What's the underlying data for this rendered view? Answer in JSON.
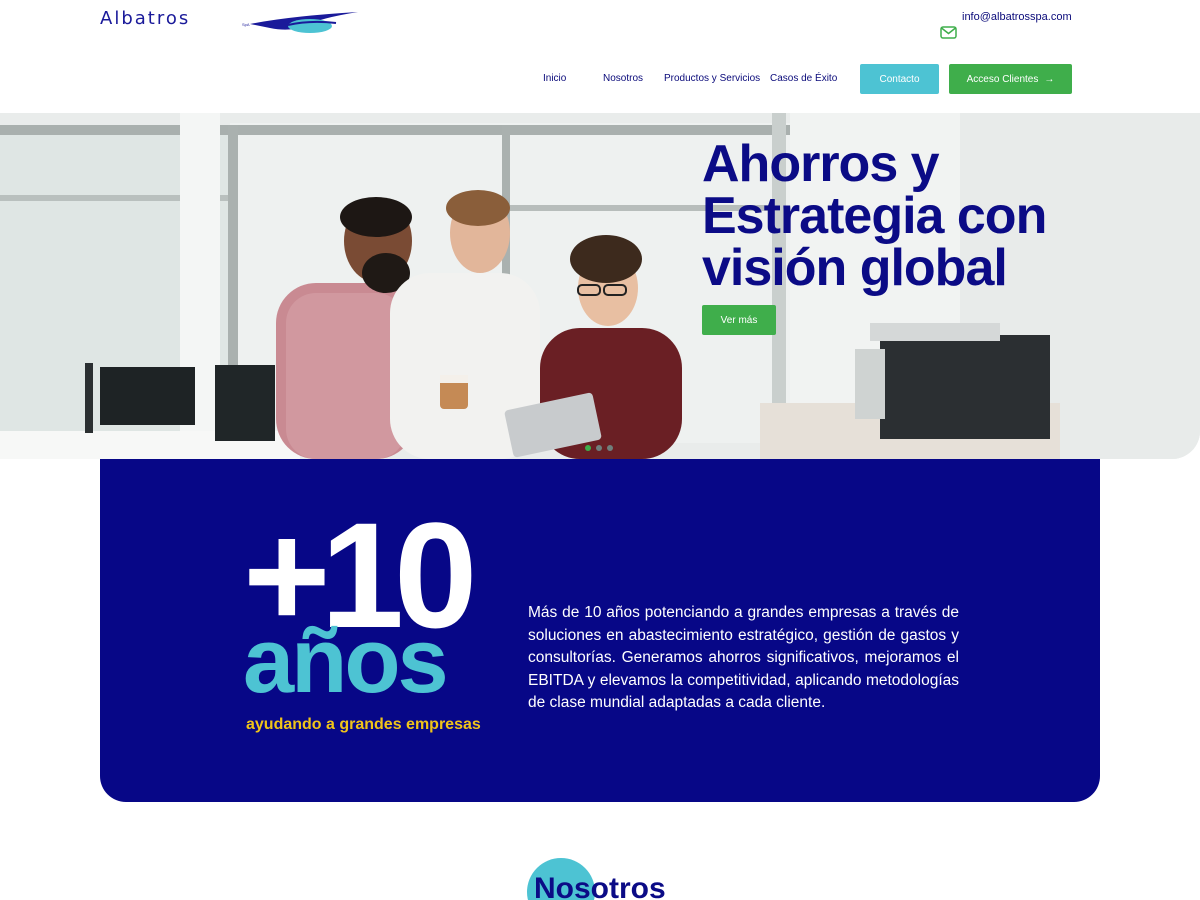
{
  "header": {
    "logo_text": "Albatros",
    "logo_sub": "SpA",
    "email": "info@albatrosspa.com",
    "nav": [
      "Inicio",
      "Nosotros",
      "Productos y Servicios",
      "Casos de Éxito"
    ],
    "contact_label": "Contacto",
    "clientes_label": "Acceso Clientes",
    "clientes_arrow": "→"
  },
  "hero": {
    "title_line1": "Ahorros y",
    "title_line2": "Estrategia con",
    "title_line3": "visión global",
    "button_label": "Ver más",
    "slides_total": 3,
    "slide_active": 1
  },
  "stats": {
    "big_number": "+10",
    "unit": "años",
    "subtitle": "ayudando a grandes empresas",
    "description": "Más de 10 años potenciando a grandes empresas a través de soluciones en abastecimiento estratégico, gestión de gastos y consultorías. Generamos ahorros significativos, mejoramos el EBITDA y elevamos la competitividad, aplicando metodologías de clase mundial adaptadas a cada cliente."
  },
  "section": {
    "nosotros_title": "Nosotros"
  },
  "colors": {
    "navy": "#070787",
    "cyan": "#4dc3d3",
    "green": "#3fae4b",
    "yellow": "#f0c419"
  }
}
